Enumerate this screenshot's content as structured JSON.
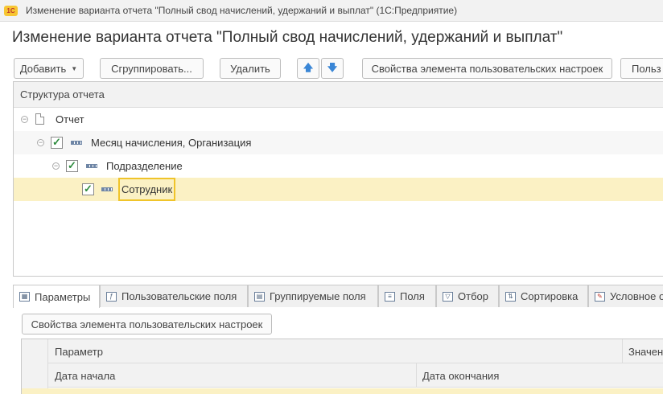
{
  "window": {
    "app_badge": "1С",
    "title": "Изменение варианта отчета \"Полный свод начислений, удержаний и выплат\"  (1С:Предприятие)"
  },
  "form": {
    "title": "Изменение варианта отчета \"Полный свод начислений, удержаний и выплат\""
  },
  "toolbar": {
    "add_label": "Добавить",
    "group_label": "Сгруппировать...",
    "delete_label": "Удалить",
    "move_up_symbol": "🡅",
    "move_down_symbol": "🡇",
    "user_settings_props_label": "Свойства элемента пользовательских настроек",
    "truncated_label": "Польз"
  },
  "tree": {
    "header": "Структура отчета",
    "rows": [
      {
        "label": "Отчет",
        "checked": false
      },
      {
        "label": "Месяц начисления, Организация",
        "checked": true
      },
      {
        "label": "Подразделение",
        "checked": true
      },
      {
        "label": "Сотрудник",
        "checked": true,
        "selected": true
      }
    ]
  },
  "tabs": [
    {
      "label": "Параметры",
      "icon": "parameters-icon",
      "active": true
    },
    {
      "label": "Пользовательские поля",
      "icon": "custom-fields-icon"
    },
    {
      "label": "Группируемые поля",
      "icon": "grouping-fields-icon"
    },
    {
      "label": "Поля",
      "icon": "fields-icon"
    },
    {
      "label": "Отбор",
      "icon": "filter-icon"
    },
    {
      "label": "Сортировка",
      "icon": "sort-icon"
    },
    {
      "label": "Условное о",
      "icon": "conditional-format-icon"
    }
  ],
  "params_panel": {
    "props_button_label": "Свойства элемента пользовательских настроек",
    "columns": {
      "parameter": "Параметр",
      "value": "Значен",
      "start_date": "Дата начала",
      "end_date": "Дата окончания"
    }
  },
  "colors": {
    "selection": "#fbf1c4",
    "focus_border": "#f0c42a",
    "checkmark": "#2e8b3e",
    "arrow": "#3a86d6"
  }
}
